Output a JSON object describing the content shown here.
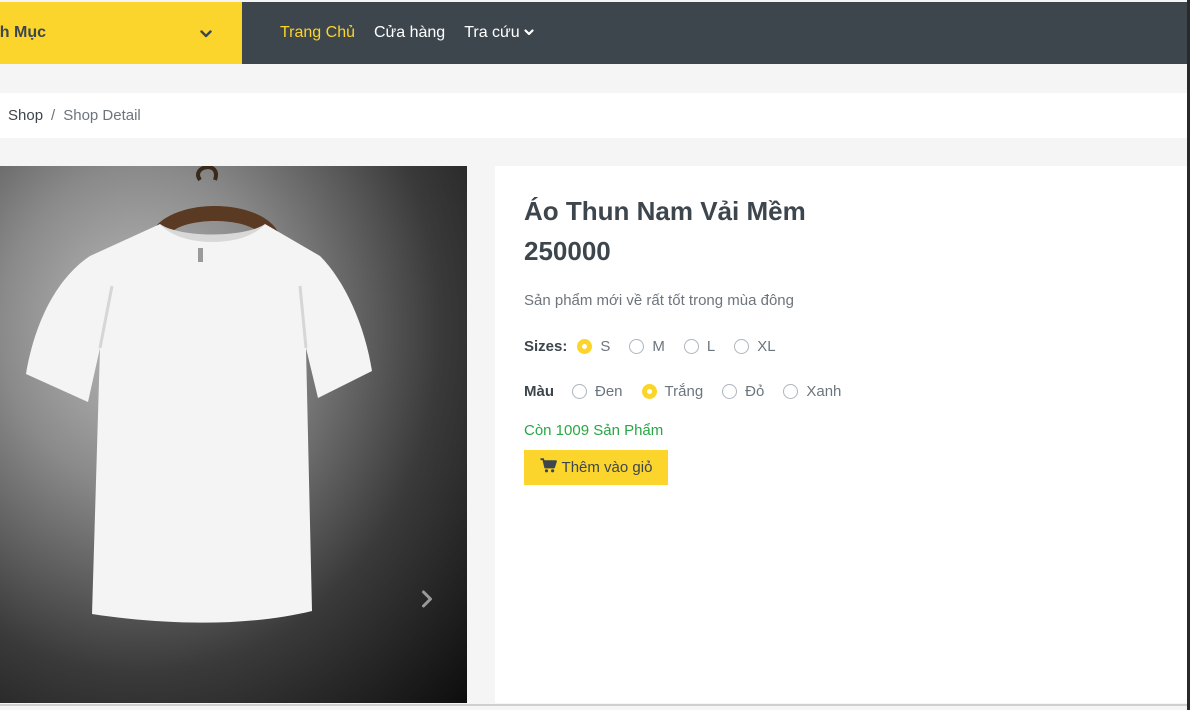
{
  "header": {
    "category_label": "nh Mục",
    "nav": [
      {
        "label": "Trang Chủ",
        "active": true
      },
      {
        "label": "Cửa hàng"
      },
      {
        "label": "Tra cứu"
      }
    ]
  },
  "breadcrumb": {
    "shop": "Shop",
    "separator": "/",
    "current": "Shop Detail"
  },
  "product": {
    "name": "Áo Thun Nam Vải Mềm",
    "price": "250000",
    "description": "Sản phẩm mới về rất tốt trong mùa đông",
    "sizes_label": "Sizes:",
    "sizes": [
      "S",
      "M",
      "L",
      "XL"
    ],
    "selected_size": "S",
    "colors_label": "Màu",
    "colors": [
      "Đen",
      "Trắng",
      "Đỏ",
      "Xanh"
    ],
    "selected_color": "Trắng",
    "stock": "Còn 1009 Sản Phẩm",
    "add_to_cart": "Thêm vào giỏ"
  },
  "colors": {
    "accent": "#fbd42c",
    "dark": "#3d464d",
    "stock_green": "#28a745"
  },
  "icons": {
    "category_chevron": "chevron-down-icon",
    "nav_dropdown": "chevron-down-icon",
    "carousel_next": "chevron-right-icon",
    "cart": "shopping-cart-icon"
  }
}
